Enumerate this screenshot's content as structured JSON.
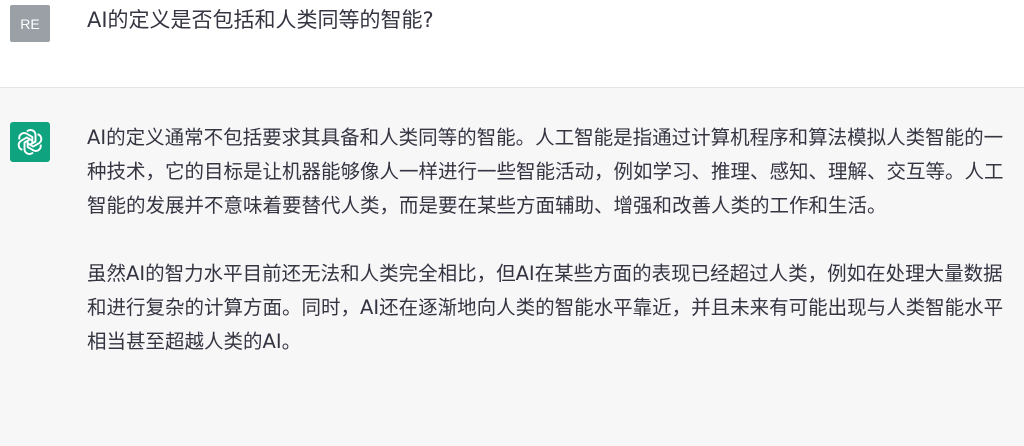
{
  "user_message": {
    "avatar_initials": "RE",
    "text": "AI的定义是否包括和人类同等的智能?"
  },
  "assistant_message": {
    "avatar_icon": "openai-logo-icon",
    "paragraphs": [
      "AI的定义通常不包括要求其具备和人类同等的智能。人工智能是指通过计算机程序和算法模拟人类智能的一种技术，它的目标是让机器能够像人一样进行一些智能活动，例如学习、推理、感知、理解、交互等。人工智能的发展并不意味着要替代人类，而是要在某些方面辅助、增强和改善人类的工作和生活。",
      "虽然AI的智力水平目前还无法和人类完全相比，但AI在某些方面的表现已经超过人类，例如在处理大量数据和进行复杂的计算方面。同时，AI还在逐渐地向人类的智能水平靠近，并且未来有可能出现与人类智能水平相当甚至超越人类的AI。"
    ]
  },
  "colors": {
    "user_avatar_bg": "#9aa0a6",
    "assistant_avatar_bg": "#10a37f",
    "assistant_bg": "#f7f7f8",
    "text": "#343541"
  }
}
